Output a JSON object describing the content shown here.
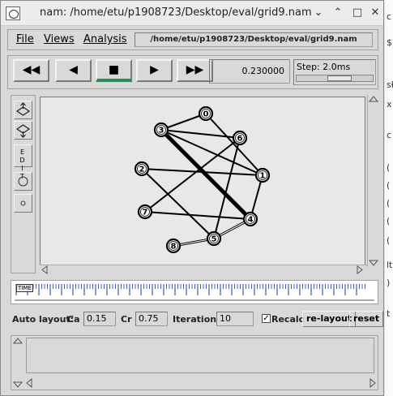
{
  "window": {
    "title": "nam: /home/etu/p1908723/Desktop/eval/grid9.nam",
    "controls": [
      "⌄",
      "⌃",
      "□",
      "✕"
    ]
  },
  "menubar": {
    "file": "File",
    "views": "Views",
    "analysis": "Analysis",
    "path": "/home/etu/p1908723/Desktop/eval/grid9.nam"
  },
  "playback": {
    "rewind": "◀◀",
    "back": "◀",
    "stop": "■",
    "play": "▶",
    "fast_forward": "▶▶",
    "time": "0.230000",
    "step_label": "Step: 2.0ms"
  },
  "tools": {
    "edit": "EDIT"
  },
  "network": {
    "nodes": [
      {
        "id": "0"
      },
      {
        "id": "1"
      },
      {
        "id": "2"
      },
      {
        "id": "3"
      },
      {
        "id": "4"
      },
      {
        "id": "5"
      },
      {
        "id": "6"
      },
      {
        "id": "7"
      },
      {
        "id": "8"
      }
    ],
    "links": [
      [
        "0",
        "3"
      ],
      [
        "0",
        "1"
      ],
      [
        "3",
        "6"
      ],
      [
        "3",
        "1"
      ],
      [
        "3",
        "4"
      ],
      [
        "6",
        "7"
      ],
      [
        "6",
        "5"
      ],
      [
        "2",
        "1"
      ],
      [
        "2",
        "5"
      ],
      [
        "7",
        "4"
      ],
      [
        "1",
        "4"
      ],
      [
        "4",
        "5"
      ],
      [
        "5",
        "8"
      ]
    ]
  },
  "timeline": {
    "label": "TIME"
  },
  "layout": {
    "auto_layout": "Auto layout:",
    "ca_label": "Ca",
    "ca_value": "0.15",
    "cr_label": "Cr",
    "cr_value": "0.75",
    "iterations_label": "Iterations",
    "iterations_value": "10",
    "recalc_label": "Recalc",
    "recalc_checked": true,
    "relayout_button": "re-layout",
    "reset_button": "reset"
  },
  "background_strip": [
    "c",
    "$",
    "sł",
    "x",
    "c",
    "(",
    "(",
    "(",
    "(",
    "(",
    "lt",
    ")",
    "t"
  ]
}
